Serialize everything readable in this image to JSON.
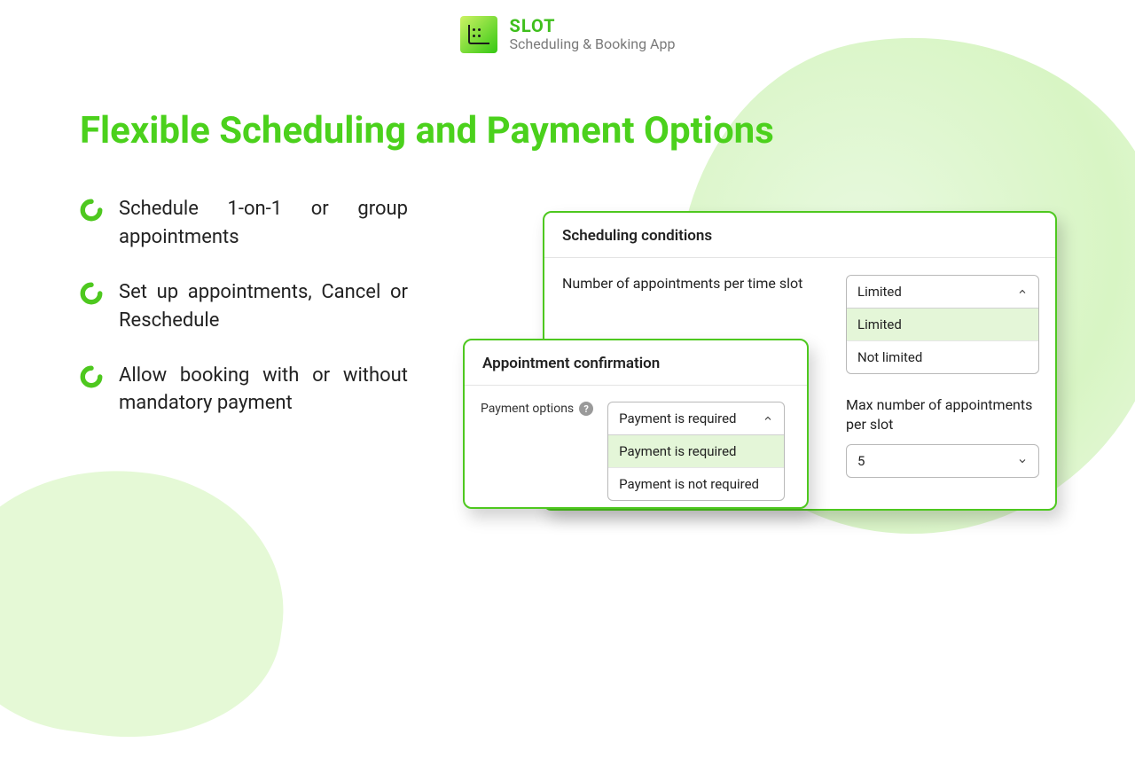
{
  "brand": {
    "name": "SLOT",
    "subtitle": "Scheduling & Booking App"
  },
  "title": "Flexible Scheduling and Payment Options",
  "bullets": [
    "Schedule 1-on-1 or group appointments",
    "Set up appointments, Cancel or Reschedule",
    "Allow booking with or without mandatory payment"
  ],
  "sched_panel": {
    "header": "Scheduling conditions",
    "field_label": "Number of appointments per time slot",
    "select_value": "Limited",
    "options": [
      "Limited",
      "Not limited"
    ],
    "max_label": "Max number of appointments per slot",
    "max_value": "5"
  },
  "confirm_panel": {
    "header": "Appointment confirmation",
    "field_label": "Payment options",
    "select_value": "Payment is required",
    "options": [
      "Payment is required",
      "Payment is not required"
    ]
  }
}
